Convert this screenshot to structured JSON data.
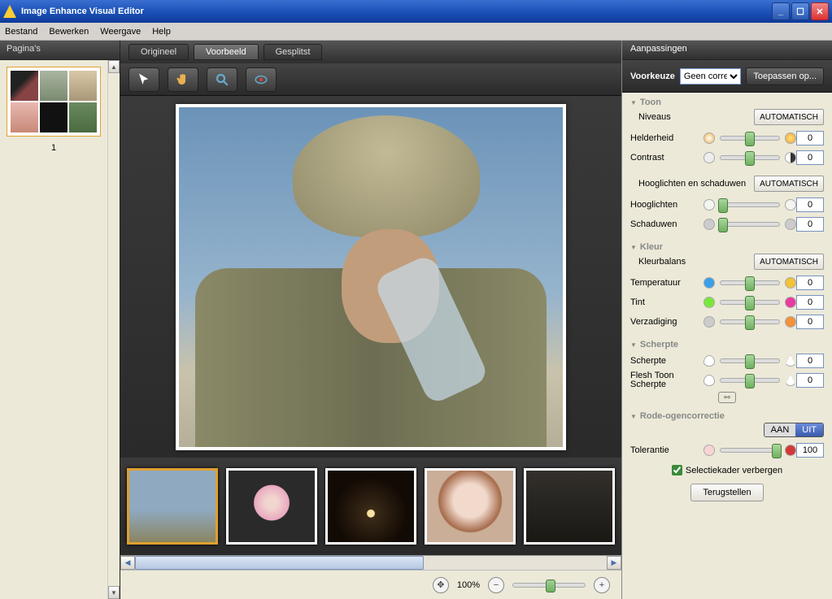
{
  "app": {
    "title": "Image Enhance Visual Editor"
  },
  "menu": {
    "file": "Bestand",
    "edit": "Bewerken",
    "view": "Weergave",
    "help": "Help"
  },
  "left": {
    "header": "Pagina's",
    "page": "1"
  },
  "tabs": {
    "original": "Origineel",
    "preview": "Voorbeeld",
    "split": "Gesplitst"
  },
  "rightHeader": "Aanpassingen",
  "preset": {
    "label": "Voorkeuze",
    "value": "Geen correctie",
    "apply": "Toepassen op..."
  },
  "sections": {
    "tone": "Toon",
    "color": "Kleur",
    "sharp": "Scherpte",
    "redeye": "Rode-ogencorrectie"
  },
  "labels": {
    "levels": "Niveaus",
    "brightness": "Helderheid",
    "contrast": "Contrast",
    "hilo": "Hooglichten en schaduwen",
    "highlights": "Hooglichten",
    "shadows": "Schaduwen",
    "colorbalance": "Kleurbalans",
    "temperature": "Temperatuur",
    "tint": "Tint",
    "saturation": "Verzadiging",
    "sharpness": "Scherpte",
    "fleshtone": "Flesh Toon Scherpte",
    "tolerance": "Tolerantie",
    "hideSel": "Selectiekader verbergen"
  },
  "values": {
    "brightness": "0",
    "contrast": "0",
    "highlights": "0",
    "shadows": "0",
    "temperature": "0",
    "tint": "0",
    "saturation": "0",
    "sharpness": "0",
    "fleshtone": "0",
    "tolerance": "100"
  },
  "buttons": {
    "auto": "AUTOMATISCH",
    "reset": "Terugstellen",
    "on": "AAN",
    "off": "UIT"
  },
  "zoom": {
    "percent": "100%"
  }
}
